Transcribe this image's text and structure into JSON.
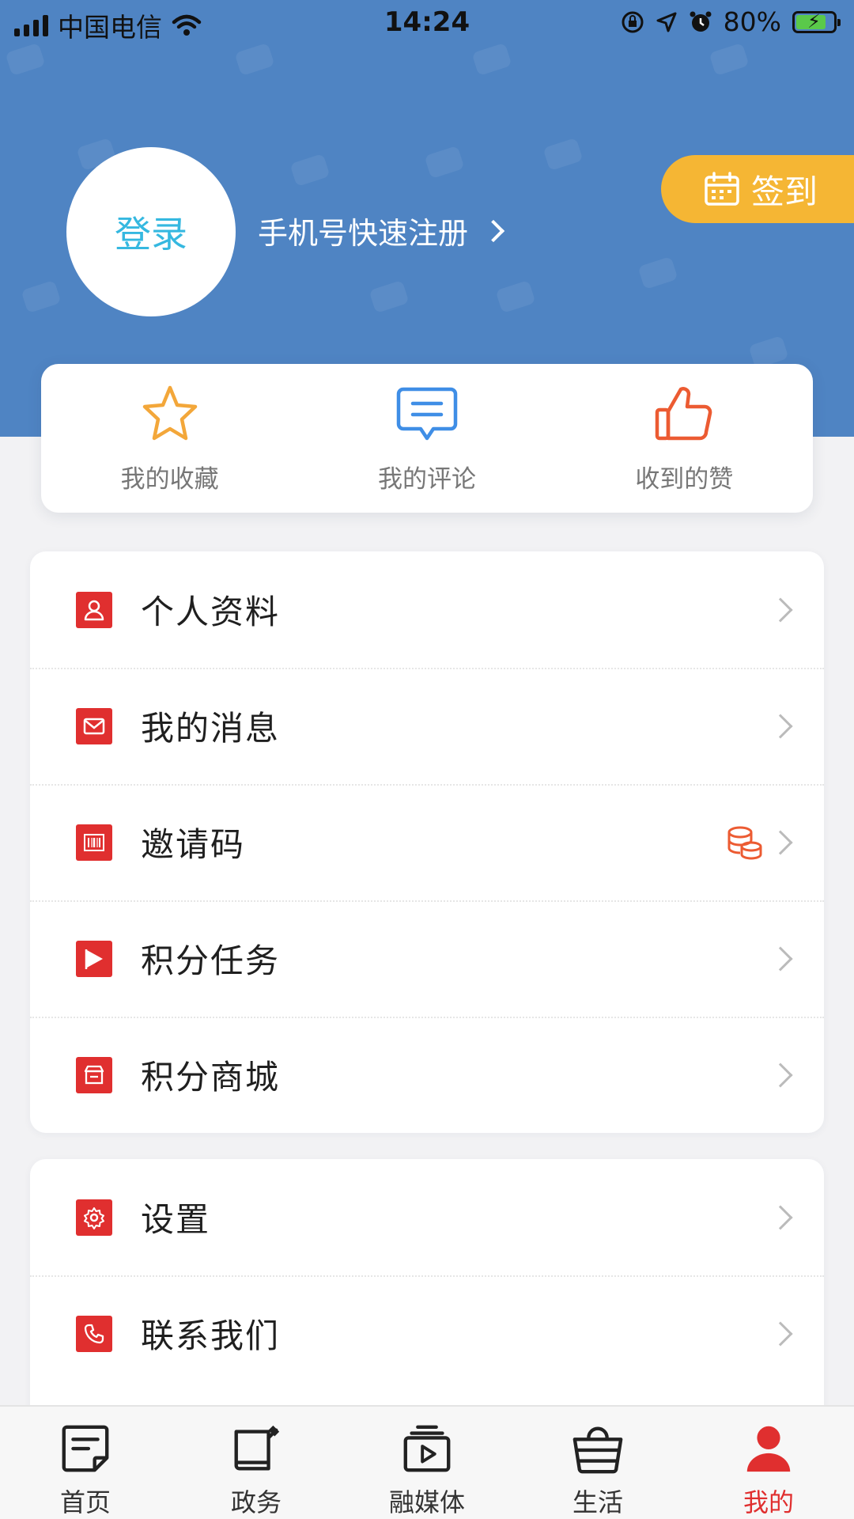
{
  "status_bar": {
    "carrier": "中国电信",
    "time": "14:24",
    "battery_percent": "80%",
    "battery_level": 0.8
  },
  "profile": {
    "login_label": "登录",
    "register_label": "手机号快速注册",
    "checkin_label": "签到"
  },
  "quick_actions": [
    {
      "label": "我的收藏",
      "icon": "star-icon"
    },
    {
      "label": "我的评论",
      "icon": "comment-icon"
    },
    {
      "label": "收到的赞",
      "icon": "thumbs-up-icon"
    }
  ],
  "menu_group_1": [
    {
      "label": "个人资料",
      "icon": "user-icon"
    },
    {
      "label": "我的消息",
      "icon": "mail-icon"
    },
    {
      "label": "邀请码",
      "icon": "barcode-icon",
      "badge_icon": "coins-icon"
    },
    {
      "label": "积分任务",
      "icon": "flag-icon"
    },
    {
      "label": "积分商城",
      "icon": "store-icon"
    }
  ],
  "menu_group_2": [
    {
      "label": "设置",
      "icon": "gear-icon"
    },
    {
      "label": "联系我们",
      "icon": "phone-icon"
    }
  ],
  "tab_bar": [
    {
      "label": "首页",
      "icon": "news-icon",
      "active": false
    },
    {
      "label": "政务",
      "icon": "government-icon",
      "active": false
    },
    {
      "label": "融媒体",
      "icon": "media-play-icon",
      "active": false
    },
    {
      "label": "生活",
      "icon": "basket-icon",
      "active": false
    },
    {
      "label": "我的",
      "icon": "person-icon",
      "active": true
    }
  ],
  "colors": {
    "header_blue": "#4f84c3",
    "accent_red": "#e02f2f",
    "checkin_yellow": "#f5b634",
    "login_text_cyan": "#35b8e0"
  }
}
